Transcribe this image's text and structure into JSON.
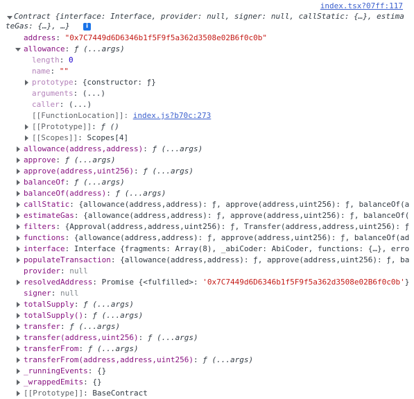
{
  "source_link": "index.tsx?07ff:117",
  "header": {
    "line1": "Contract {interface: Interface, provider: null, signer: null, callStatic: {…}, estima",
    "line2": "teGas: {…}, …}",
    "info_glyph": "i"
  },
  "address": {
    "key": "address",
    "value": "\"0x7C7449d6D6346b1f5F9f5a362d3508e02B6f0c0b\""
  },
  "allowance": {
    "key": "allowance",
    "value": "ƒ (...args)",
    "children": {
      "length_key": "length",
      "length_val": "0",
      "name_key": "name",
      "name_val": "\"\"",
      "prototype_key": "prototype",
      "prototype_val": "{constructor: ƒ}",
      "arguments_key": "arguments",
      "arguments_val": "(...)",
      "caller_key": "caller",
      "caller_val": "(...)",
      "fnloc_key": "[[FunctionLocation]]:",
      "fnloc_val": "index.js?b70c:273",
      "proto_key": "[[Prototype]]",
      "proto_val": "ƒ ()",
      "scopes_key": "[[Scopes]]",
      "scopes_val": "Scopes[4]"
    }
  },
  "props": [
    {
      "key": "allowance(address,address)",
      "value": "ƒ (...args)"
    },
    {
      "key": "approve",
      "value": "ƒ (...args)"
    },
    {
      "key": "approve(address,uint256)",
      "value": "ƒ (...args)"
    },
    {
      "key": "balanceOf",
      "value": "ƒ (...args)"
    },
    {
      "key": "balanceOf(address)",
      "value": "ƒ (...args)"
    },
    {
      "key": "callStatic",
      "value": "{allowance(address,address): ƒ, approve(address,uint256): ƒ, balanceOf(a"
    },
    {
      "key": "estimateGas",
      "value": "{allowance(address,address): ƒ, approve(address,uint256): ƒ, balanceOf("
    },
    {
      "key": "filters",
      "value": "{Approval(address,address,uint256): ƒ, Transfer(address,address,uint256): ƒ"
    },
    {
      "key": "functions",
      "value": "{allowance(address,address): ƒ, approve(address,uint256): ƒ, balanceOf(ad"
    },
    {
      "key": "interface",
      "value": "Interface {fragments: Array(8), _abiCoder: AbiCoder, functions: {…}, erro"
    },
    {
      "key": "populateTransaction",
      "value": "{allowance(address,address): ƒ, approve(address,uint256): ƒ, ba"
    }
  ],
  "provider": {
    "key": "provider",
    "value": "null"
  },
  "resolvedAddress": {
    "key": "resolvedAddress",
    "value_prefix": "Promise {<fulfilled>: ",
    "value_str": "'0x7C7449d6D6346b1f5F9f5a362d3508e02B6f0c0b'",
    "value_suffix": "}"
  },
  "signer": {
    "key": "signer",
    "value": "null"
  },
  "props2": [
    {
      "key": "totalSupply",
      "value": "ƒ (...args)"
    },
    {
      "key": "totalSupply()",
      "value": "ƒ (...args)"
    },
    {
      "key": "transfer",
      "value": "ƒ (...args)"
    },
    {
      "key": "transfer(address,uint256)",
      "value": "ƒ (...args)"
    },
    {
      "key": "transferFrom",
      "value": "ƒ (...args)"
    },
    {
      "key": "transferFrom(address,address,uint256)",
      "value": "ƒ (...args)"
    },
    {
      "key": "_runningEvents",
      "value": "{}"
    },
    {
      "key": "_wrappedEmits",
      "value": "{}"
    }
  ],
  "proto": {
    "key": "[[Prototype]]",
    "value": "BaseContract"
  }
}
